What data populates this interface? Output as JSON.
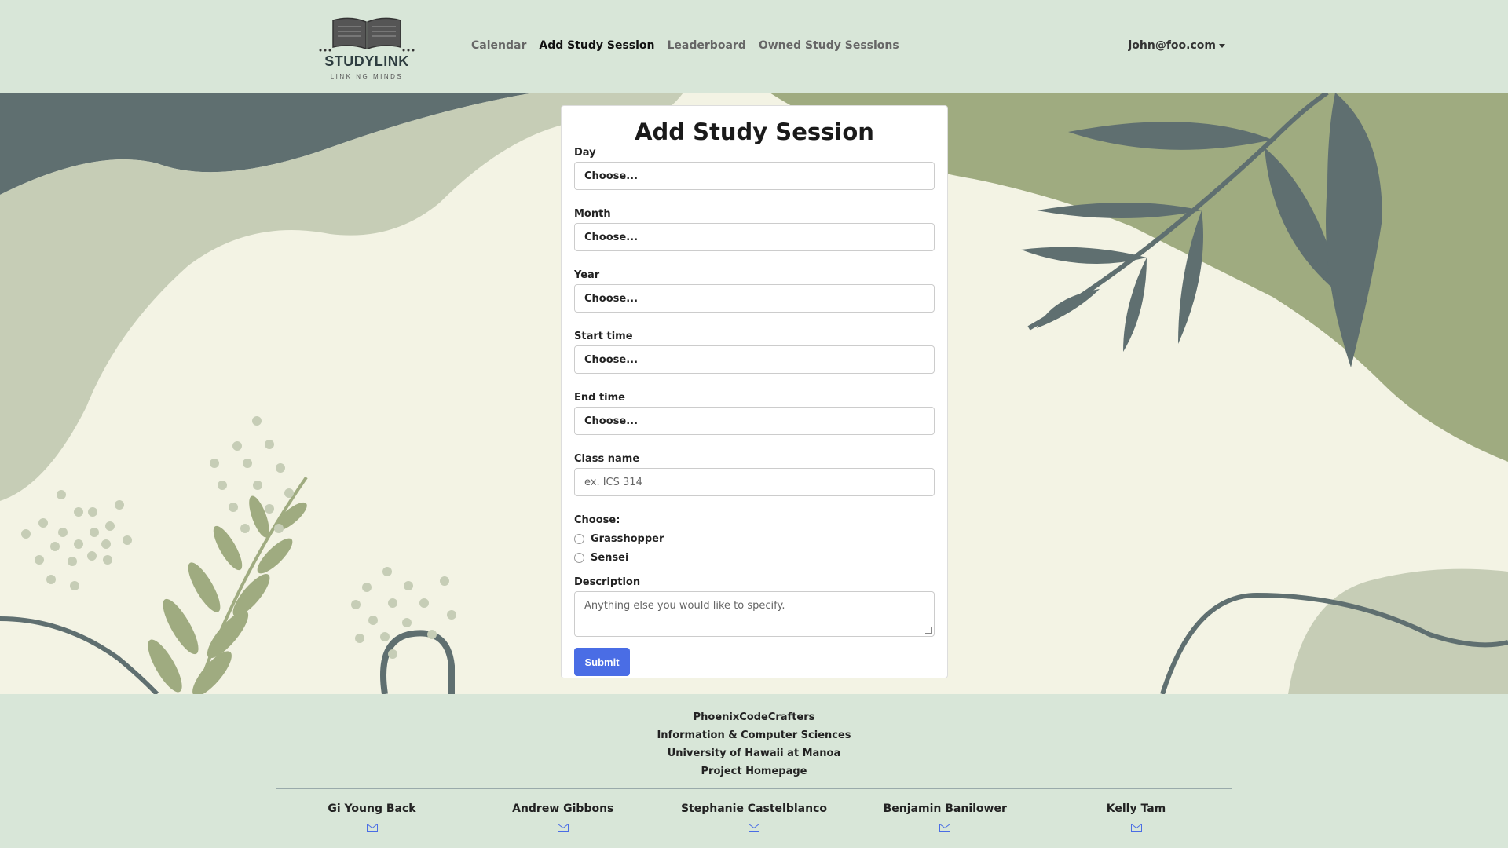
{
  "navbar": {
    "logo_title": "STUDYLINK",
    "logo_subtitle": "LINKING MINDS",
    "links": [
      {
        "label": "Calendar"
      },
      {
        "label": "Add Study Session"
      },
      {
        "label": "Leaderboard"
      },
      {
        "label": "Owned Study Sessions"
      }
    ],
    "user": "john@foo.com"
  },
  "form": {
    "title": "Add Study Session",
    "fields": {
      "day": {
        "label": "Day",
        "value": "Choose..."
      },
      "month": {
        "label": "Month",
        "value": "Choose..."
      },
      "year": {
        "label": "Year",
        "value": "Choose..."
      },
      "start_time": {
        "label": "Start time",
        "value": "Choose..."
      },
      "end_time": {
        "label": "End time",
        "value": "Choose..."
      },
      "class_name": {
        "label": "Class name",
        "placeholder": "ex. ICS 314"
      }
    },
    "role": {
      "label": "Choose:",
      "options": [
        "Grasshopper",
        "Sensei"
      ]
    },
    "description": {
      "label": "Description",
      "placeholder": "Anything else you would like to specify."
    },
    "submit_label": "Submit"
  },
  "footer": {
    "lines": [
      "PhoenixCodeCrafters",
      "Information & Computer Sciences",
      "University of Hawaii at Manoa",
      "Project Homepage"
    ],
    "members": [
      "Gi Young Back",
      "Andrew Gibbons",
      "Stephanie Castelblanco",
      "Benjamin Banilower",
      "Kelly Tam"
    ]
  },
  "colors": {
    "nav_bg": "#d8e6d8",
    "accent": "#4a6de5",
    "leaf_dark": "#5f6f70",
    "leaf_green": "#9fab80"
  }
}
